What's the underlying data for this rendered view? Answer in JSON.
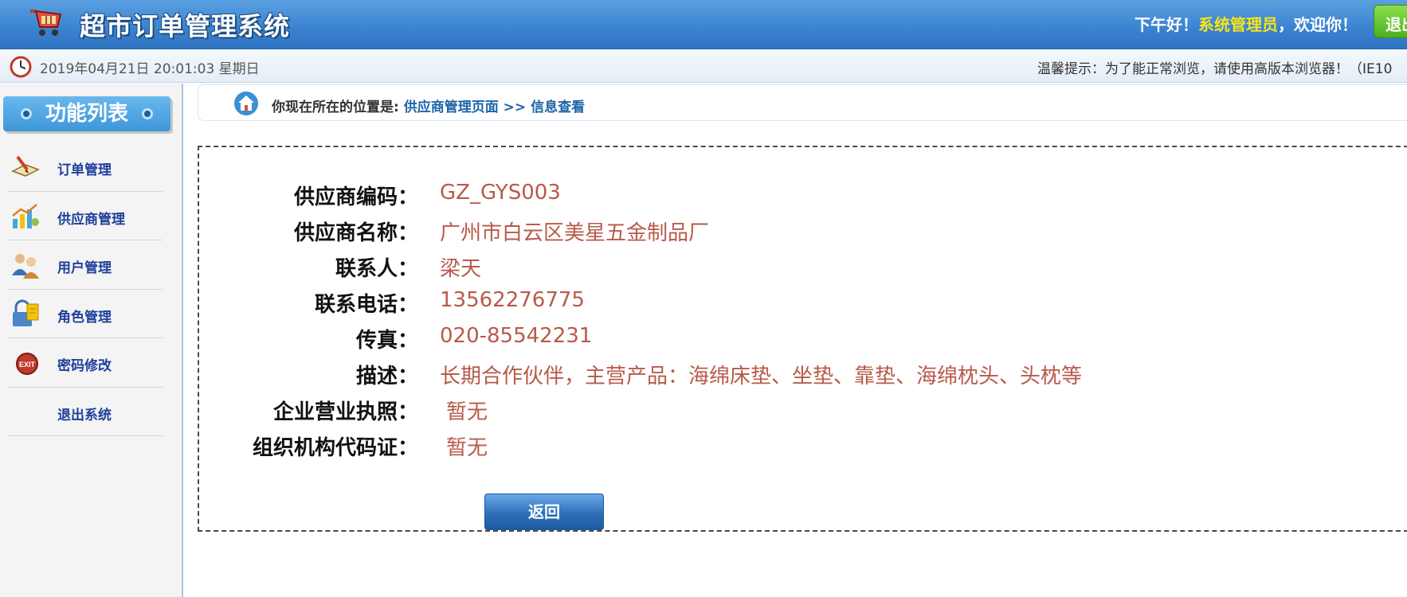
{
  "header": {
    "app_title": "超市订单管理系统",
    "greeting_prefix": "下午好！",
    "user_name": "系统管理员",
    "greeting_suffix": "，欢迎你！",
    "logout_label": "退出"
  },
  "infobar": {
    "datetime": "2019年04月21日 20:01:03 星期日",
    "tip": "温馨提示：为了能正常浏览，请使用高版本浏览器！（IE10"
  },
  "sidebar": {
    "title": "功能列表",
    "items": [
      {
        "label": "订单管理",
        "icon": "order-book-icon"
      },
      {
        "label": "供应商管理",
        "icon": "supplier-chart-icon"
      },
      {
        "label": "用户管理",
        "icon": "users-icon"
      },
      {
        "label": "角色管理",
        "icon": "role-lock-icon"
      },
      {
        "label": "密码修改",
        "icon": "exit-badge-icon"
      },
      {
        "label": "退出系统",
        "icon": ""
      }
    ]
  },
  "breadcrumb": {
    "prefix": "你现在所在的位置是:",
    "page": "供应商管理页面",
    "separator": ">>",
    "current": "信息查看"
  },
  "detail": {
    "fields": [
      {
        "label": "供应商编码：",
        "value": "GZ_GYS003"
      },
      {
        "label": "供应商名称：",
        "value": "广州市白云区美星五金制品厂"
      },
      {
        "label": "联系人：",
        "value": "梁天"
      },
      {
        "label": "联系电话：",
        "value": "13562276775"
      },
      {
        "label": "传真：",
        "value": "020-85542231"
      },
      {
        "label": "描述：",
        "value": "长期合作伙伴，主营产品：海绵床垫、坐垫、靠垫、海绵枕头、头枕等"
      },
      {
        "label": "企业营业执照：",
        "value": "暂无"
      },
      {
        "label": "组织机构代码证：",
        "value": "暂无"
      }
    ],
    "back_label": "返回"
  },
  "colors": {
    "header_blue": "#3a82d0",
    "value_red": "#b85a4a",
    "link_blue": "#1d63a8",
    "username_yellow": "#f4e51a",
    "logout_green": "#4caf1e"
  }
}
